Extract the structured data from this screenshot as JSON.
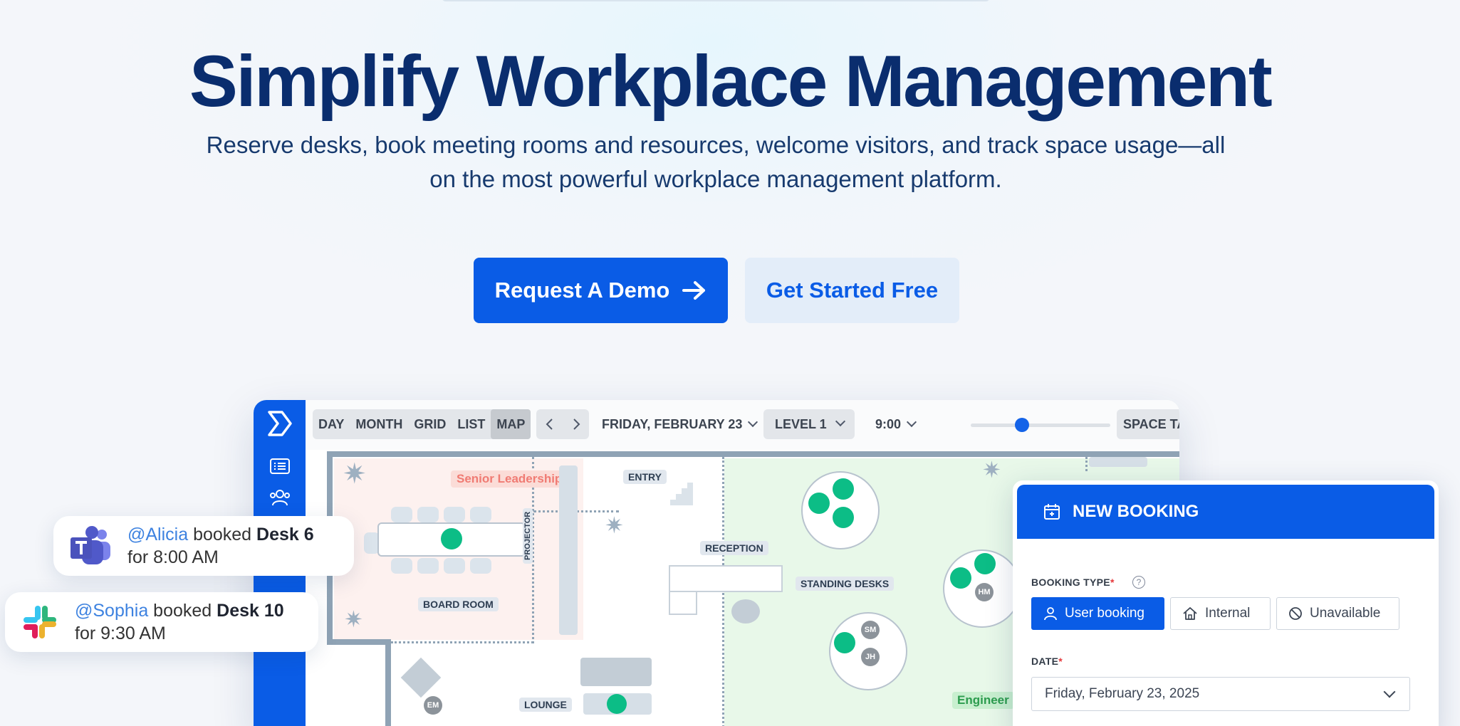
{
  "hero": {
    "title": "Simplify Workplace Management",
    "subtitle_line1": "Reserve desks, book meeting rooms and resources, welcome visitors, and track space usage—all",
    "subtitle_line2": "on the most powerful workplace management platform.",
    "primary_cta": "Request A Demo",
    "secondary_cta": "Get Started Free"
  },
  "colors": {
    "brand": "#0a5ce6",
    "heading": "#0a2d6e",
    "desk_available": "#0cbd86"
  },
  "toolbar": {
    "views": [
      "DAY",
      "MONTH",
      "GRID",
      "LIST",
      "MAP"
    ],
    "active_view": "MAP",
    "date": "FRIDAY, FEBRUARY 23",
    "level": "LEVEL 1",
    "time": "9:00",
    "tags": "SPACE TAGS"
  },
  "plan": {
    "senior_label": "Senior Leadership",
    "board_room": "BOARD ROOM",
    "projector": "PROJECTOR",
    "entry": "ENTRY",
    "reception": "RECEPTION",
    "standing_desks": "STANDING DESKS",
    "lounge": "LOUNGE",
    "engineering": "Engineer",
    "initials": [
      "HM",
      "SM",
      "JH",
      "EM"
    ]
  },
  "booking": {
    "title": "NEW BOOKING",
    "type_label": "BOOKING TYPE",
    "types": [
      "User booking",
      "Internal",
      "Unavailable"
    ],
    "selected_type": "User booking",
    "date_label": "DATE",
    "date_value": "Friday, February 23, 2025"
  },
  "notifications": [
    {
      "app": "teams",
      "user": "@Alicia",
      "verb": " booked ",
      "desk": "Desk 6",
      "time": "for 8:00 AM"
    },
    {
      "app": "slack",
      "user": "@Sophia",
      "verb": " booked ",
      "desk": "Desk 10",
      "time": "for 9:30 AM"
    }
  ]
}
